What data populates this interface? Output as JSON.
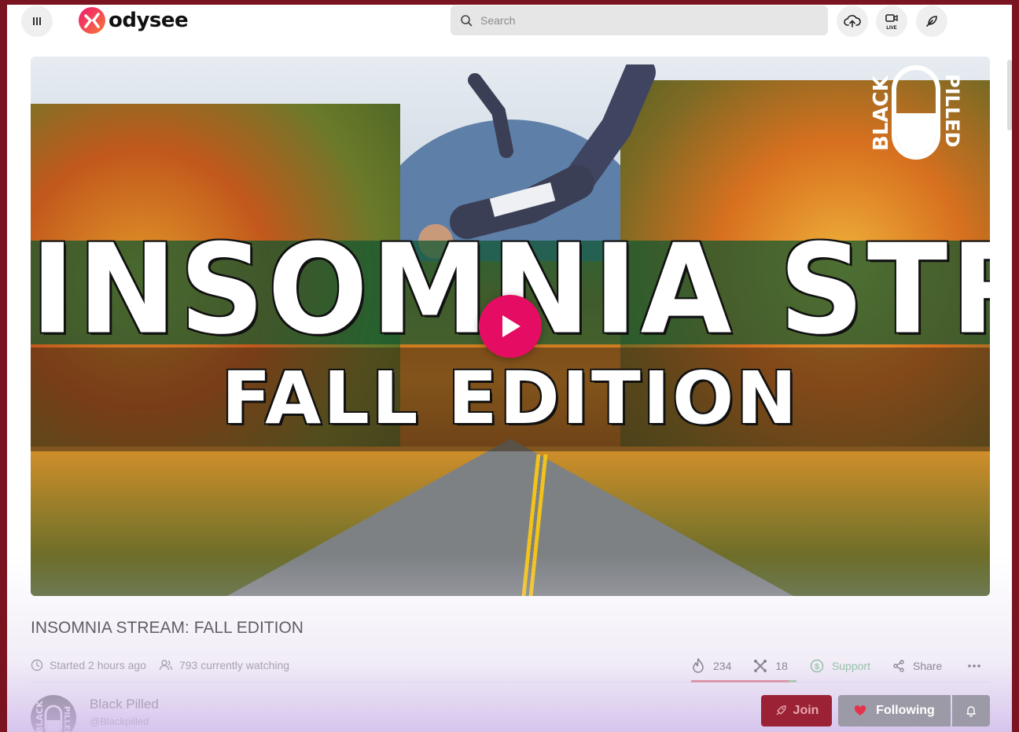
{
  "app": {
    "logo_text": "odysee"
  },
  "header": {
    "search": {
      "placeholder": "Search"
    },
    "live_label": "LIVE"
  },
  "video": {
    "thumbnail_title": "INSOMNIA STREAM",
    "thumbnail_subtitle": "FALL EDITION",
    "brand_badge_left": "BLACK",
    "brand_badge_right": "PILLED"
  },
  "stream": {
    "title": "INSOMNIA STREAM: FALL EDITION",
    "started": "Started 2 hours ago",
    "watching": "793 currently watching"
  },
  "actions": {
    "fire_count": "234",
    "slime_count": "18",
    "support_label": "Support",
    "share_label": "Share"
  },
  "channel": {
    "name": "Black Pilled",
    "handle": "@Blackpilled",
    "avatar_text_left": "BLACK",
    "avatar_text_right": "PILLED",
    "join_label": "Join",
    "following_label": "Following"
  },
  "colors": {
    "accent_pink": "#e50d63",
    "support_green": "#2e9e4a",
    "join_red": "#9a2234",
    "fire_bar": "#d12b2b",
    "slime_bar": "#54b34a"
  }
}
